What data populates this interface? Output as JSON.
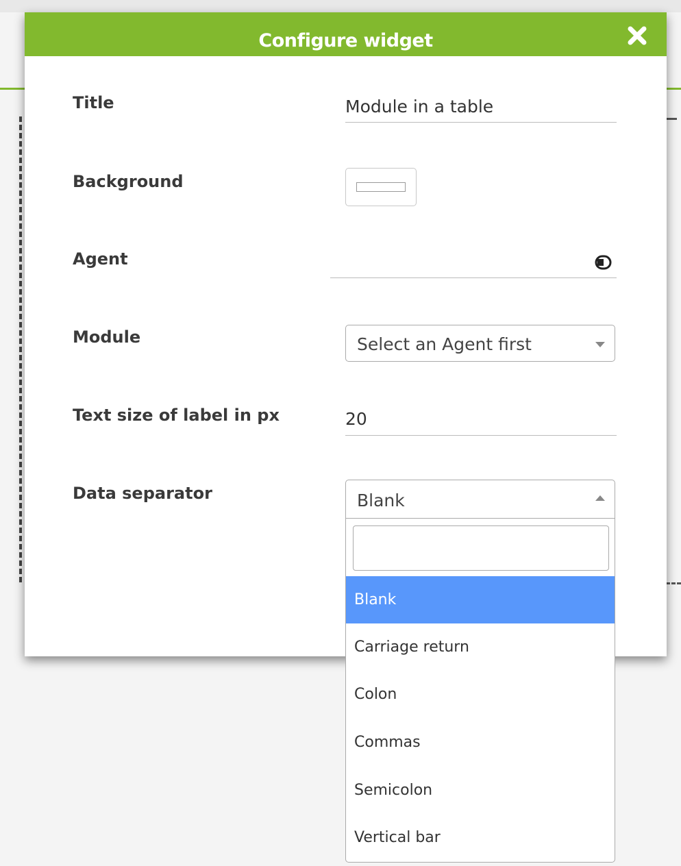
{
  "dialog": {
    "title": "Configure widget",
    "header_color": "#82b92e",
    "close_icon": "close-icon"
  },
  "fields": {
    "title": {
      "label": "Title",
      "value": "Module in a table"
    },
    "background": {
      "label": "Background",
      "color": "#ffffff"
    },
    "agent": {
      "label": "Agent",
      "value": "",
      "icon": "agent-lookup-icon"
    },
    "module": {
      "label": "Module",
      "selected": "Select an Agent first"
    },
    "text_size": {
      "label": "Text size of label in px",
      "value": "20"
    },
    "data_separator": {
      "label": "Data separator",
      "selected": "Blank",
      "search_value": "",
      "options": [
        "Blank",
        "Carriage return",
        "Colon",
        "Commas",
        "Semicolon",
        "Vertical bar"
      ],
      "highlight_color": "#5897fb"
    }
  }
}
